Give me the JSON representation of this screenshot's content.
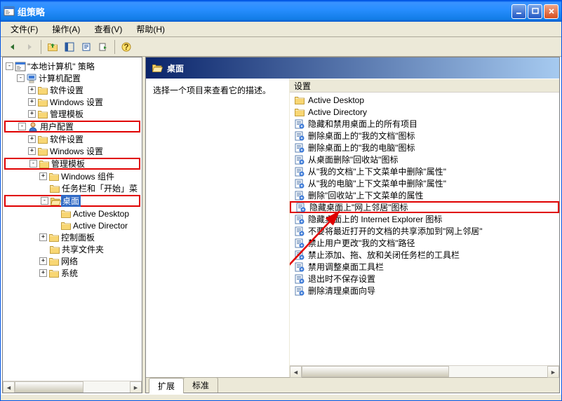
{
  "window": {
    "title": "组策略"
  },
  "menu": {
    "file": "文件(F)",
    "action": "操作(A)",
    "view": "查看(V)",
    "help": "帮助(H)"
  },
  "tree": {
    "root": "\"本地计算机\" 策略",
    "computer": "计算机配置",
    "comp_soft": "软件设置",
    "comp_win": "Windows 设置",
    "comp_admin": "管理模板",
    "user": "用户配置",
    "user_soft": "软件设置",
    "user_win": "Windows 设置",
    "user_admin": "管理模板",
    "win_comp": "Windows 组件",
    "taskbar": "任务栏和「开始」菜",
    "desktop": "桌面",
    "active_desktop": "Active Desktop",
    "active_directory": "Active Director",
    "control_panel": "控制面板",
    "shared_folders": "共享文件夹",
    "network": "网络",
    "system": "系统"
  },
  "header": {
    "title": "桌面"
  },
  "desc": {
    "text": "选择一个项目来查看它的描述。"
  },
  "list_header": {
    "label": "设置"
  },
  "list": [
    {
      "type": "folder",
      "label": "Active Desktop"
    },
    {
      "type": "folder",
      "label": "Active Directory"
    },
    {
      "type": "policy",
      "label": "隐藏和禁用桌面上的所有项目"
    },
    {
      "type": "policy",
      "label": "删除桌面上的\"我的文档\"图标"
    },
    {
      "type": "policy",
      "label": "删除桌面上的\"我的电脑\"图标"
    },
    {
      "type": "policy",
      "label": "从桌面删除\"回收站\"图标"
    },
    {
      "type": "policy",
      "label": "从\"我的文档\"上下文菜单中删除\"属性\""
    },
    {
      "type": "policy",
      "label": "从\"我的电脑\"上下文菜单中删除\"属性\""
    },
    {
      "type": "policy",
      "label": "删除\"回收站\"上下文菜单的属性"
    },
    {
      "type": "policy",
      "label": "隐藏桌面上\"网上邻居\"图标",
      "highlight": true
    },
    {
      "type": "policy",
      "label": "隐藏桌面上的 Internet Explorer 图标"
    },
    {
      "type": "policy",
      "label": "不要将最近打开的文档的共享添加到\"网上邻居\""
    },
    {
      "type": "policy",
      "label": "禁止用户更改\"我的文档\"路径"
    },
    {
      "type": "policy",
      "label": "禁止添加、拖、放和关闭任务栏的工具栏"
    },
    {
      "type": "policy",
      "label": "禁用调整桌面工具栏"
    },
    {
      "type": "policy",
      "label": "退出时不保存设置"
    },
    {
      "type": "policy",
      "label": "删除清理桌面向导"
    }
  ],
  "tabs": {
    "extended": "扩展",
    "standard": "标准"
  }
}
